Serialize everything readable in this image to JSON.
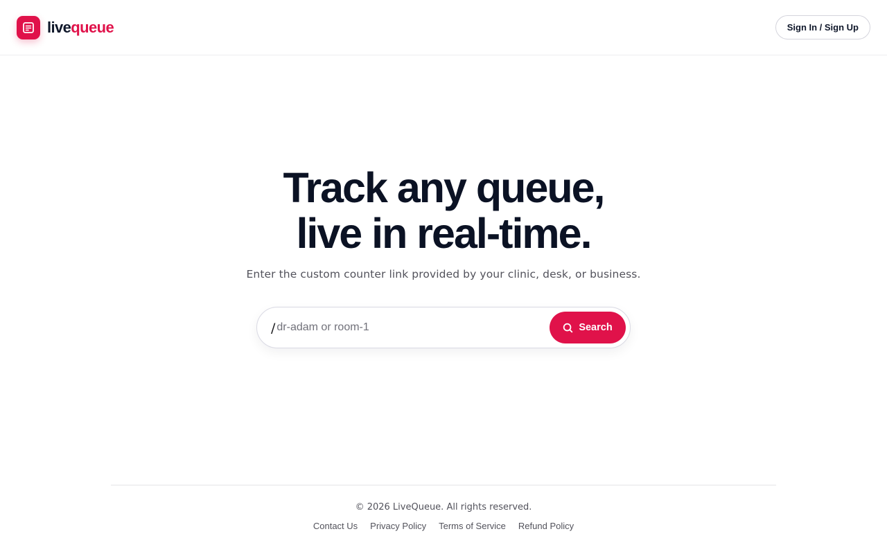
{
  "header": {
    "brand": {
      "part_a": "live",
      "part_b": "queue",
      "icon": "queue-list-icon"
    },
    "signin_label": "Sign In / Sign Up"
  },
  "hero": {
    "title_line1": "Track any queue,",
    "title_line2": "live in real-time.",
    "subtitle": "Enter the custom counter link provided by your clinic, desk, or business."
  },
  "search": {
    "prefix": "/",
    "placeholder": "dr-adam or room-1",
    "value": "",
    "button_label": "Search",
    "button_icon": "search-icon"
  },
  "footer": {
    "copyright": "© 2026 LiveQueue. All rights reserved.",
    "links": [
      "Contact Us",
      "Privacy Policy",
      "Terms of Service",
      "Refund Policy"
    ]
  },
  "colors": {
    "accent": "#e0124a",
    "text": "#0f172a",
    "muted": "#52525b",
    "border": "#ececf0"
  }
}
